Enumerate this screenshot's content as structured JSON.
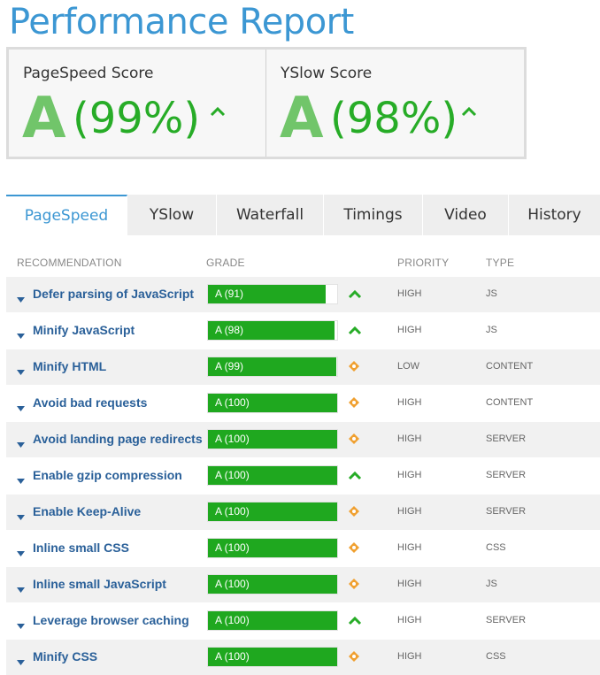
{
  "page": {
    "title": "Performance Report"
  },
  "scores": [
    {
      "label": "PageSpeed Score",
      "grade": "A",
      "percent": "(99%)"
    },
    {
      "label": "YSlow Score",
      "grade": "A",
      "percent": "(98%)"
    }
  ],
  "tabs": [
    {
      "label": "PageSpeed",
      "active": true
    },
    {
      "label": "YSlow",
      "active": false
    },
    {
      "label": "Waterfall",
      "active": false
    },
    {
      "label": "Timings",
      "active": false
    },
    {
      "label": "Video",
      "active": false
    },
    {
      "label": "History",
      "active": false
    }
  ],
  "table": {
    "headers": {
      "recommendation": "RECOMMENDATION",
      "grade": "GRADE",
      "priority": "PRIORITY",
      "type": "TYPE"
    },
    "rows": [
      {
        "recommendation": "Defer parsing of JavaScript",
        "grade": "A (91)",
        "score": 91,
        "indicator": "up",
        "priority": "HIGH",
        "type": "JS"
      },
      {
        "recommendation": "Minify JavaScript",
        "grade": "A (98)",
        "score": 98,
        "indicator": "up",
        "priority": "HIGH",
        "type": "JS"
      },
      {
        "recommendation": "Minify HTML",
        "grade": "A (99)",
        "score": 99,
        "indicator": "neutral",
        "priority": "LOW",
        "type": "CONTENT"
      },
      {
        "recommendation": "Avoid bad requests",
        "grade": "A (100)",
        "score": 100,
        "indicator": "neutral",
        "priority": "HIGH",
        "type": "CONTENT"
      },
      {
        "recommendation": "Avoid landing page redirects",
        "grade": "A (100)",
        "score": 100,
        "indicator": "neutral",
        "priority": "HIGH",
        "type": "SERVER"
      },
      {
        "recommendation": "Enable gzip compression",
        "grade": "A (100)",
        "score": 100,
        "indicator": "up",
        "priority": "HIGH",
        "type": "SERVER"
      },
      {
        "recommendation": "Enable Keep-Alive",
        "grade": "A (100)",
        "score": 100,
        "indicator": "neutral",
        "priority": "HIGH",
        "type": "SERVER"
      },
      {
        "recommendation": "Inline small CSS",
        "grade": "A (100)",
        "score": 100,
        "indicator": "neutral",
        "priority": "HIGH",
        "type": "CSS"
      },
      {
        "recommendation": "Inline small JavaScript",
        "grade": "A (100)",
        "score": 100,
        "indicator": "neutral",
        "priority": "HIGH",
        "type": "JS"
      },
      {
        "recommendation": "Leverage browser caching",
        "grade": "A (100)",
        "score": 100,
        "indicator": "up",
        "priority": "HIGH",
        "type": "SERVER"
      },
      {
        "recommendation": "Minify CSS",
        "grade": "A (100)",
        "score": 100,
        "indicator": "neutral",
        "priority": "HIGH",
        "type": "CSS"
      }
    ]
  },
  "colors": {
    "title": "#3c97d3",
    "link": "#2a6099",
    "bar": "#1fa81f",
    "up_indicator": "#27ac27",
    "neutral_indicator": "#f0a030"
  },
  "icons": {
    "up": "chevron-up-icon",
    "neutral": "diamond-icon",
    "expand": "caret-down-icon"
  }
}
